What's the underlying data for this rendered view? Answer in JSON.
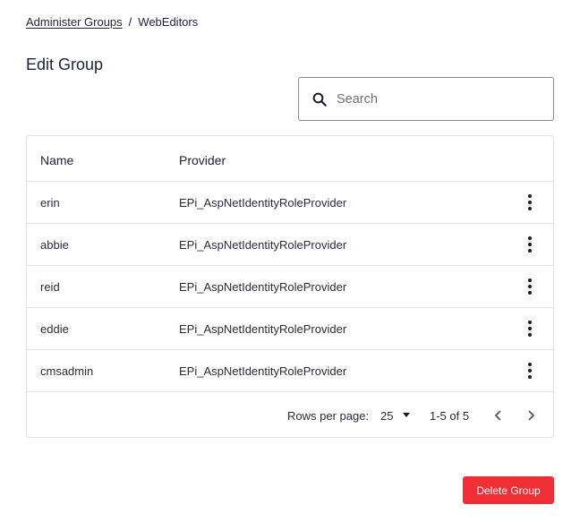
{
  "breadcrumb": {
    "parent": "Administer Groups",
    "separator": "/",
    "current": "WebEditors"
  },
  "page_title": "Edit Group",
  "search": {
    "placeholder": "Search",
    "value": "",
    "icon": "search-icon"
  },
  "table": {
    "columns": {
      "name": "Name",
      "provider": "Provider"
    },
    "rows": [
      {
        "name": "erin",
        "provider": "EPi_AspNetIdentityRoleProvider"
      },
      {
        "name": "abbie",
        "provider": "EPi_AspNetIdentityRoleProvider"
      },
      {
        "name": "reid",
        "provider": "EPi_AspNetIdentityRoleProvider"
      },
      {
        "name": "eddie",
        "provider": "EPi_AspNetIdentityRoleProvider"
      },
      {
        "name": "cmsadmin",
        "provider": "EPi_AspNetIdentityRoleProvider"
      }
    ],
    "row_action_icon": "more-vertical-icon"
  },
  "pagination": {
    "rows_per_page_label": "Rows per page:",
    "rows_per_page_value": "25",
    "range_label": "1-5 of 5",
    "prev_icon": "chevron-left-icon",
    "next_icon": "chevron-right-icon"
  },
  "actions": {
    "delete_label": "Delete Group",
    "delete_color": "#ef2e35"
  }
}
